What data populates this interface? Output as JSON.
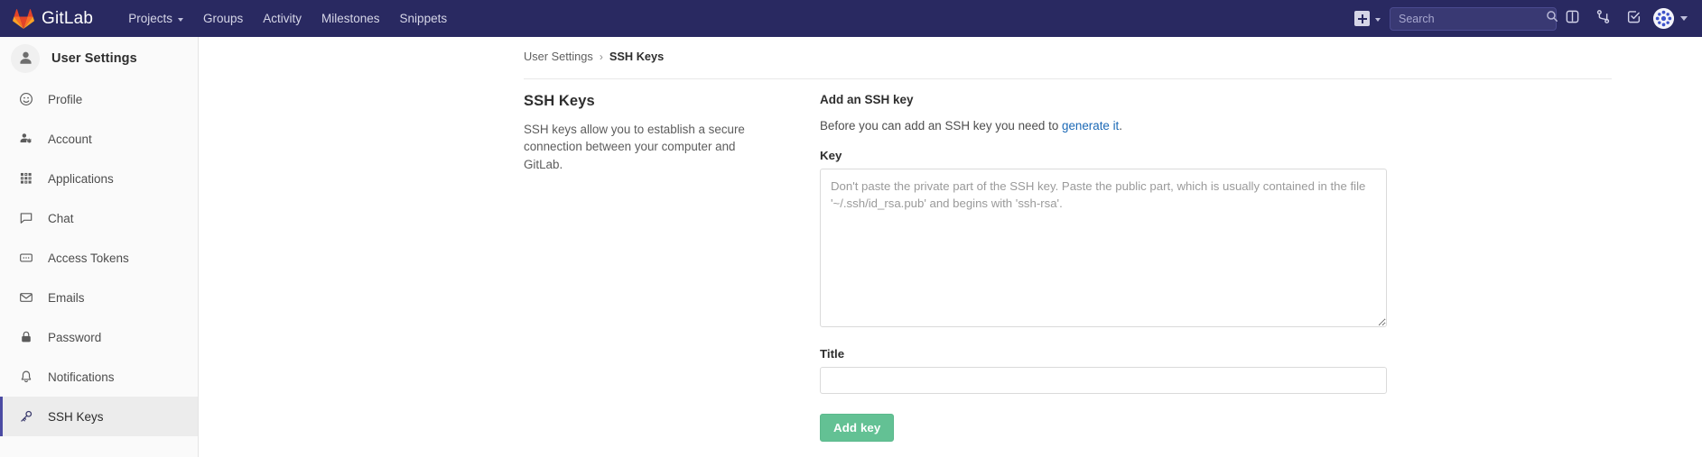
{
  "topnav": {
    "brand": "GitLab",
    "brand_icon": "gitlab-fox-logo",
    "links": [
      {
        "label": "Projects",
        "has_caret": true
      },
      {
        "label": "Groups",
        "has_caret": false
      },
      {
        "label": "Activity",
        "has_caret": false
      },
      {
        "label": "Milestones",
        "has_caret": false
      },
      {
        "label": "Snippets",
        "has_caret": false
      }
    ],
    "create_new_icon": "plus-square-icon",
    "search": {
      "value": "",
      "placeholder": "Search",
      "icon": "search-icon"
    },
    "icons": [
      {
        "name": "issues-icon"
      },
      {
        "name": "merge-requests-icon"
      },
      {
        "name": "todos-checkmark-icon"
      }
    ],
    "avatar_icon": "user-avatar-identicon",
    "bg_color": "#292961"
  },
  "sidebar": {
    "header_label": "User Settings",
    "header_icon": "user-avatar-icon",
    "items": [
      {
        "label": "Profile",
        "icon": "profile-circle-icon",
        "active": false
      },
      {
        "label": "Account",
        "icon": "account-gear-icon",
        "active": false
      },
      {
        "label": "Applications",
        "icon": "applications-grid-icon",
        "active": false
      },
      {
        "label": "Chat",
        "icon": "chat-bubble-icon",
        "active": false
      },
      {
        "label": "Access Tokens",
        "icon": "access-token-card-icon",
        "active": false
      },
      {
        "label": "Emails",
        "icon": "envelope-icon",
        "active": false
      },
      {
        "label": "Password",
        "icon": "lock-icon",
        "active": false
      },
      {
        "label": "Notifications",
        "icon": "bell-icon",
        "active": false
      },
      {
        "label": "SSH Keys",
        "icon": "key-icon",
        "active": true
      }
    ],
    "active_accent": "#4b4ba3",
    "active_bg": "#ececec"
  },
  "breadcrumb": {
    "parent": "User Settings",
    "separator": "›",
    "current": "SSH Keys"
  },
  "main": {
    "section_title": "SSH Keys",
    "section_description": "SSH keys allow you to establish a secure connection between your computer and GitLab.",
    "form_title": "Add an SSH key",
    "form_note_prefix": "Before you can add an SSH key you need to ",
    "form_note_link": "generate it",
    "form_note_suffix": ".",
    "key_label": "Key",
    "key_value": "",
    "key_placeholder": "Don't paste the private part of the SSH key. Paste the public part, which is usually contained in the file '~/.ssh/id_rsa.pub' and begins with 'ssh-rsa'.",
    "title_label": "Title",
    "title_value": "",
    "title_placeholder": "",
    "submit_label": "Add key",
    "submit_color": "#63c194",
    "link_color": "#1b69b6"
  }
}
